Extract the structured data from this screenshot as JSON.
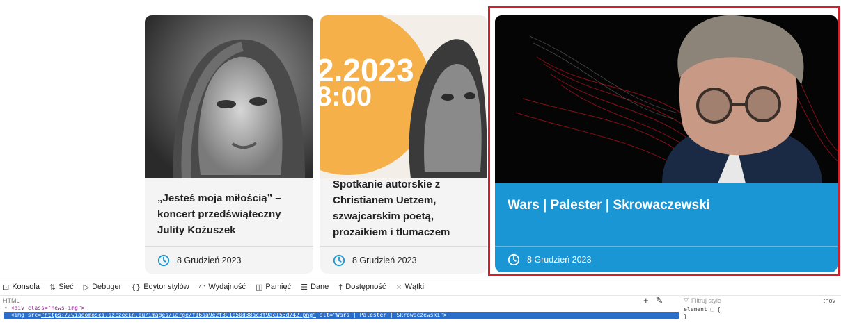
{
  "cards": [
    {
      "title": "„Jesteś moja miłością” – koncert przedświąteczny Julity Kożuszek",
      "date": "8 Grudzień 2023"
    },
    {
      "title": "Spotkanie autorskie z Christianem Uetzem, szwajcarskim poetą, prozaikiem i tłumaczem",
      "date": "8 Grudzień 2023",
      "poster_text_line1": "2.2023",
      "poster_text_line2": "8:00"
    },
    {
      "title": "Wars | Palester | Skrowaczewski",
      "date": "8 Grudzień 2023"
    }
  ],
  "devtools": {
    "tabs": [
      {
        "label": "Konsola",
        "icon": "console-icon"
      },
      {
        "label": "Sieć",
        "icon": "network-icon"
      },
      {
        "label": "Debuger",
        "icon": "debugger-icon"
      },
      {
        "label": "Edytor stylów",
        "icon": "style-editor-icon"
      },
      {
        "label": "Wydajność",
        "icon": "performance-icon"
      },
      {
        "label": "Pamięć",
        "icon": "memory-icon"
      },
      {
        "label": "Dane",
        "icon": "storage-icon"
      },
      {
        "label": "Dostępność",
        "icon": "accessibility-icon"
      },
      {
        "label": "Wątki",
        "icon": "threads-icon"
      }
    ],
    "html_label": "HTML",
    "filter_placeholder": "Filtruj style",
    "hov_label": ":hov",
    "code_line1": "<div class=\"news-img\">",
    "code_line2_tag": "<img src=",
    "code_line2_src": "\"https://wiadomosci.szczecin.eu/images/large/f16aa9e2f391e50d38ac3f9ac153d742.png\"",
    "code_line2_alt_attr": " alt=",
    "code_line2_alt_val": "\"Wars | Palester | Skrowaczewski\">",
    "rule_line1": "element ⬚ {",
    "rule_line2": "}"
  },
  "colors": {
    "highlight_card": "#1a96d4",
    "selection_border": "#d41f2b",
    "clock_blue": "#1a96d4"
  }
}
